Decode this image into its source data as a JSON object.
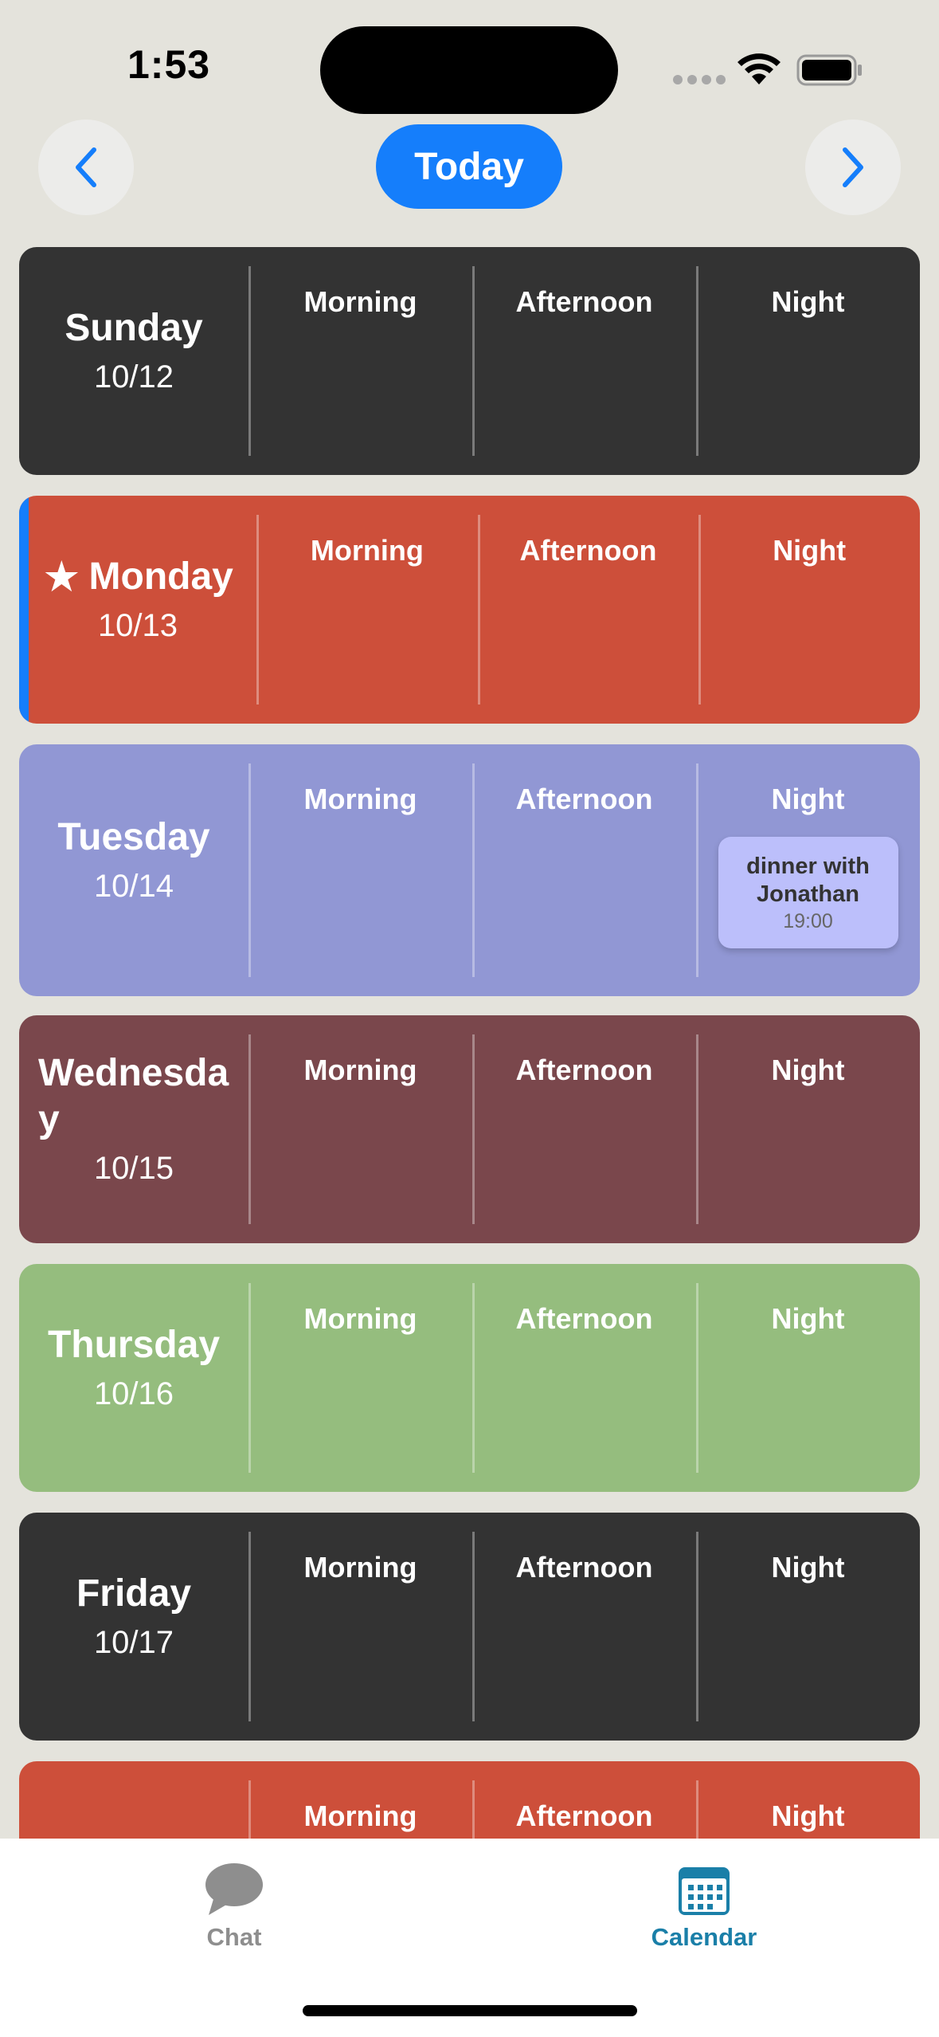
{
  "status_bar": {
    "time": "1:53"
  },
  "nav": {
    "today_label": "Today"
  },
  "slot_labels": [
    "Morning",
    "Afternoon",
    "Night"
  ],
  "days": [
    {
      "name": "Sunday",
      "date": "10/12",
      "color": "#333333"
    },
    {
      "name": "Monday",
      "date": "10/13",
      "color": "#cd4f3a",
      "is_today": true
    },
    {
      "name": "Tuesday",
      "date": "10/14",
      "color": "#9197d4",
      "event": {
        "slot": "Night",
        "title": "dinner with Jonathan",
        "time": "19:00"
      }
    },
    {
      "name": "Wednesday",
      "date": "10/15",
      "color": "#7a474c"
    },
    {
      "name": "Thursday",
      "date": "10/16",
      "color": "#95bd7e"
    },
    {
      "name": "Friday",
      "date": "10/17",
      "color": "#333333"
    },
    {
      "name": "",
      "date": "",
      "color": "#cd4f3a"
    }
  ],
  "tabs": [
    {
      "label": "Chat",
      "icon": "chat-bubble-icon",
      "active": false,
      "color": "#8e8e8e"
    },
    {
      "label": "Calendar",
      "icon": "calendar-icon",
      "active": true,
      "color": "#1a7fa8"
    }
  ]
}
